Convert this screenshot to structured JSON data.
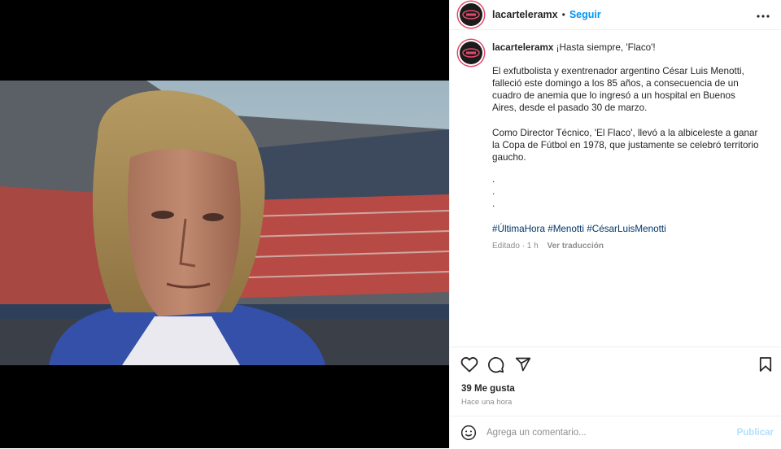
{
  "post": {
    "username": "lacarteleramx",
    "follow_label": "Seguir",
    "dot": "•",
    "caption_title": "¡Hasta siempre, 'Flaco'!",
    "paragraph1": "El exfutbolista y exentrenador argentino César Luis Menotti, falleció este domingo a los 85 años, a consecuencia de un cuadro de anemia que lo ingresó a un hospital en Buenos Aires, desde el pasado 30 de marzo.",
    "paragraph2": "Como Director Técnico, 'El Flaco', llevó a la albiceleste a ganar la Copa de Fútbol en 1978, que justamente se celebró territorio gaucho.",
    "dots": [
      ".",
      ".",
      "."
    ],
    "hashtags": "#ÚltimaHora #Menotti #CésarLuisMenotti",
    "edited": "Editado · 1 h",
    "translate_label": "Ver traducción",
    "likes": "39 Me gusta",
    "timestamp": "Hace una hora"
  },
  "comment": {
    "placeholder": "Agrega un comentario...",
    "publish_label": "Publicar"
  },
  "icons": {
    "more": "more-horizontal-icon",
    "like": "heart-icon",
    "comment": "comment-icon",
    "share": "paper-plane-icon",
    "save": "bookmark-icon",
    "emoji": "emoji-icon"
  },
  "colors": {
    "link": "#0095f6",
    "hashtag": "#00376b",
    "muted": "#8e8e8e",
    "avatar_ring": "#e14a6b"
  }
}
